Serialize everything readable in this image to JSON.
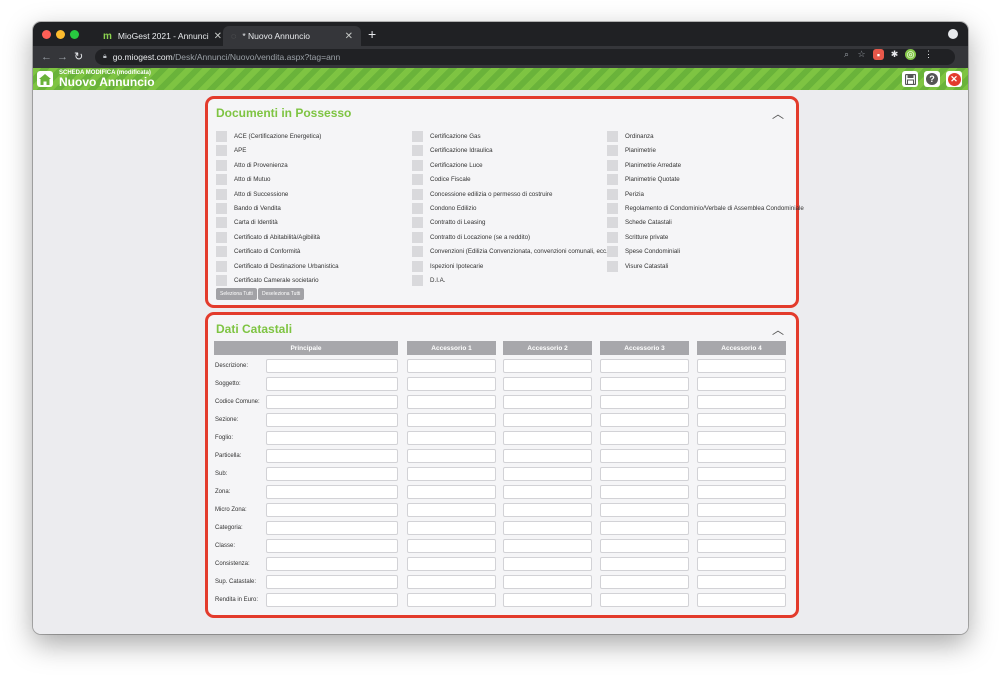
{
  "browser": {
    "tabs": [
      {
        "title": "MioGest 2021 - Annunci",
        "active": false
      },
      {
        "title": "* Nuovo Annuncio",
        "active": true
      }
    ],
    "url_host": "go.miogest.com",
    "url_path": "/Desk/Annunci/Nuovo/vendita.aspx?tag=ann",
    "colors": {
      "close": "#ff5f57",
      "minimize": "#febc2e",
      "maximize": "#28c840"
    }
  },
  "header": {
    "subtitle": "SCHEDA MODIFICA (modificata)",
    "title": "Nuovo Annuncio",
    "accent": "#7ec442"
  },
  "documents": {
    "title": "Documenti in Possesso",
    "columns": [
      [
        "ACE (Certificazione Energetica)",
        "APE",
        "Atto di Provenienza",
        "Atto di Mutuo",
        "Atto di Successione",
        "Bando di Vendita",
        "Carta di Identità",
        "Certificato di Abitabilità/Agibilità",
        "Certificato di Conformità",
        "Certificato di Destinazione Urbanistica",
        "Certificato Camerale societario"
      ],
      [
        "Certificazione Gas",
        "Certificazione Idraulica",
        "Certificazione Luce",
        "Codice Fiscale",
        "Concessione edilizia o permesso di costruire",
        "Condono Edilizio",
        "Contratto di Leasing",
        "Contratto di Locazione (se a reddito)",
        "Convenzioni (Edilizia Convenzionata, convenzioni comunali, ecc..",
        "Ispezioni Ipotecarie",
        "D.I.A."
      ],
      [
        "Ordinanza",
        "Planimetrie",
        "Planimetrie Arredate",
        "Planimetrie Quotate",
        "Perizia",
        "Regolamento di Condominio/Verbale di Assemblea Condominiale",
        "Schede Catastali",
        "Scritture private",
        "Spese Condominiali",
        "Visure Catastali"
      ]
    ],
    "select_all": "Seleziona Tutti",
    "deselect_all": "Deseleziona Tutti"
  },
  "cadastral": {
    "title": "Dati Catastali",
    "columns": [
      "Principale",
      "Accessorio 1",
      "Accessorio 2",
      "Accessorio 3",
      "Accessorio 4"
    ],
    "rows": [
      "Descrizione:",
      "Soggetto:",
      "Codice Comune:",
      "Sezione:",
      "Foglio:",
      "Particella:",
      "Sub:",
      "Zona:",
      "Micro Zona:",
      "Categoria:",
      "Classe:",
      "Consistenza:",
      "Sup. Catastale:",
      "Rendita in Euro:"
    ]
  }
}
